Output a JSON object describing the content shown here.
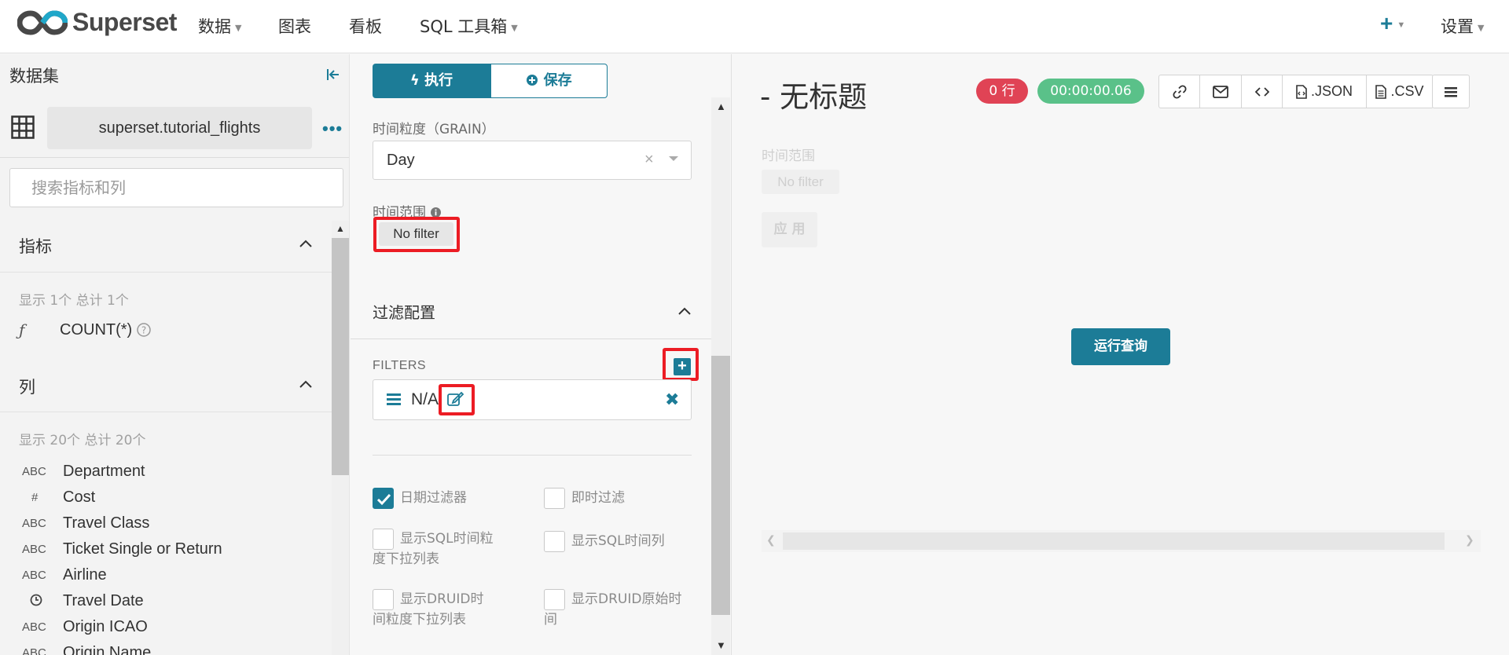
{
  "nav": {
    "brand": "Superset",
    "menu": [
      {
        "label": "数据",
        "dropdown": true
      },
      {
        "label": "图表",
        "dropdown": false
      },
      {
        "label": "看板",
        "dropdown": false
      },
      {
        "label": "SQL 工具箱",
        "dropdown": true
      }
    ],
    "plus_icon": "plus-icon",
    "settings_label": "设置"
  },
  "datasource": {
    "title": "数据集",
    "name": "superset.tutorial_flights",
    "search_placeholder": "搜索指标和列",
    "metrics_section": {
      "title": "指标",
      "summary": "显示 1个 总计 1个",
      "items": [
        {
          "type_icon": "ƒ",
          "name": "COUNT(*)"
        }
      ]
    },
    "columns_section": {
      "title": "列",
      "summary": "显示 20个 总计 20个",
      "items": [
        {
          "type": "ABC",
          "name": "Department"
        },
        {
          "type": "#",
          "name": "Cost"
        },
        {
          "type": "ABC",
          "name": "Travel Class"
        },
        {
          "type": "ABC",
          "name": "Ticket Single or Return"
        },
        {
          "type": "ABC",
          "name": "Airline"
        },
        {
          "type": "clock",
          "name": "Travel Date"
        },
        {
          "type": "ABC",
          "name": "Origin ICAO"
        },
        {
          "type": "ABC",
          "name": "Origin Name"
        }
      ]
    }
  },
  "controls": {
    "run_label": "执行",
    "save_label": "保存",
    "grain_label": "时间粒度（GRAIN）",
    "grain_value": "Day",
    "time_range_label": "时间范围",
    "time_range_value": "No filter",
    "filter_section_title": "过滤配置",
    "filters_label": "FILTERS",
    "filter_item": "N/A",
    "checkboxes": [
      {
        "label": "日期过滤器",
        "checked": true
      },
      {
        "label": "即时过滤",
        "checked": false
      },
      {
        "label": "显示SQL时间粒度下拉列表",
        "checked": false
      },
      {
        "label": "显示SQL时间列",
        "checked": false
      },
      {
        "label": "显示DRUID时间粒度下拉列表",
        "checked": false
      },
      {
        "label": "显示DRUID原始时间",
        "checked": false
      }
    ]
  },
  "chart": {
    "title": "- 无标题",
    "rows_badge": "0 行",
    "time_badge": "00:00:00.06",
    "toolbar": {
      "json_label": ".JSON",
      "csv_label": ".CSV"
    },
    "filter_box_label": "时间范围",
    "filter_box_value": "No filter",
    "apply_label": "应 用",
    "run_query_label": "运行查询"
  },
  "colors": {
    "primary": "#1c7c97",
    "danger_badge": "#e04355",
    "success_badge": "#5ac189",
    "highlight_box": "#ec1c24"
  }
}
